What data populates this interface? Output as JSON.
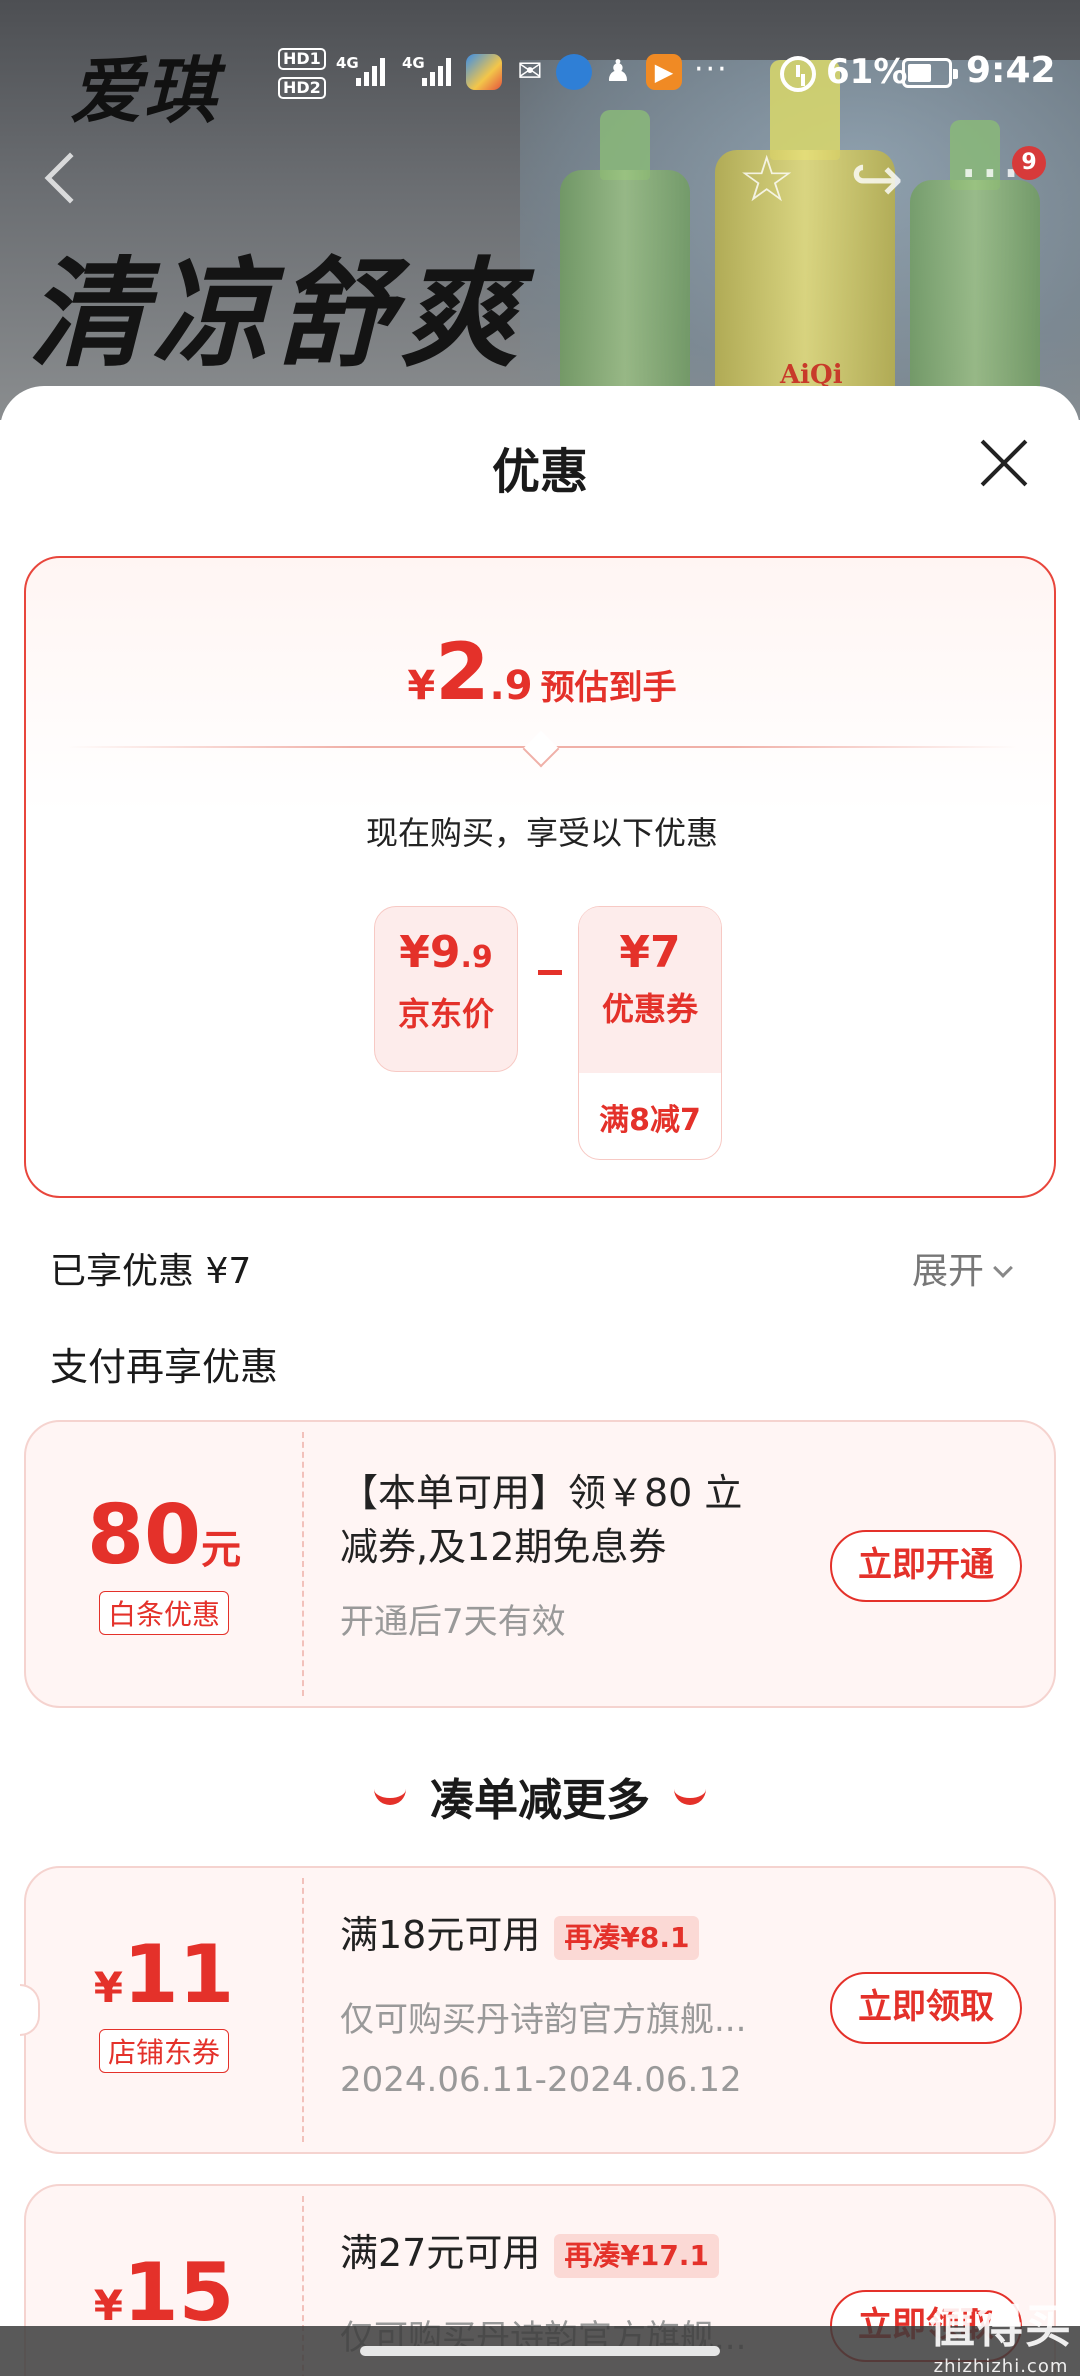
{
  "banner": {
    "brand": "爱琪",
    "headline": "清凉舒爽",
    "bottle_label": "AiQi"
  },
  "status_bar": {
    "hd1": "HD1",
    "hd2": "HD2",
    "net1": "4G",
    "net2": "4G",
    "more": "···",
    "battery_percent": "61%",
    "battery_level": 0.61,
    "time": "9:42"
  },
  "nav": {
    "badge_count": "9",
    "more_icon": "⋯",
    "favorite_icon": "☆",
    "share_icon": "↪"
  },
  "sheet": {
    "title": "优惠",
    "estimate": {
      "yen": "¥",
      "int": "2",
      "dec": ".9",
      "label": "预估到手"
    },
    "buy_line": "现在购买，享受以下优惠",
    "jd_price": {
      "yen": "¥",
      "int": "9",
      "dec": ".9",
      "label": "京东价"
    },
    "minus": "-",
    "coupon_discount": {
      "amount": "¥7",
      "label": "优惠券",
      "condition": "满8减7"
    },
    "enjoyed": "已享优惠 ¥7",
    "expand": "展开",
    "pay_more": "支付再享优惠"
  },
  "baitiao": {
    "amount": "80",
    "unit": "元",
    "tag": "白条优惠",
    "title_line1": "【本单可用】领￥80 立",
    "title_line2": "减券,及12期免息券",
    "validity": "开通后7天有效",
    "button": "立即开通"
  },
  "stack_section": {
    "title": "凑单减更多"
  },
  "coupons": [
    {
      "yen": "¥",
      "amount": "11",
      "tag": "店铺东券",
      "title": "满18元可用",
      "more": "再凑¥8.1",
      "desc": "仅可购买丹诗韵官方旗舰...",
      "date": "2024.06.11-2024.06.12",
      "button": "立即领取"
    },
    {
      "yen": "¥",
      "amount": "15",
      "title": "满27元可用",
      "more": "再凑¥17.1",
      "desc": "仅可购买丹诗韵官方旗舰...",
      "button": "立即领取"
    }
  ],
  "watermark": {
    "main": "值得买",
    "url": "zhizhizhi.com"
  },
  "colors": {
    "accent": "#e4312a",
    "coupon_bg": "#fff5f4",
    "chip_bg": "#fdeceb"
  }
}
